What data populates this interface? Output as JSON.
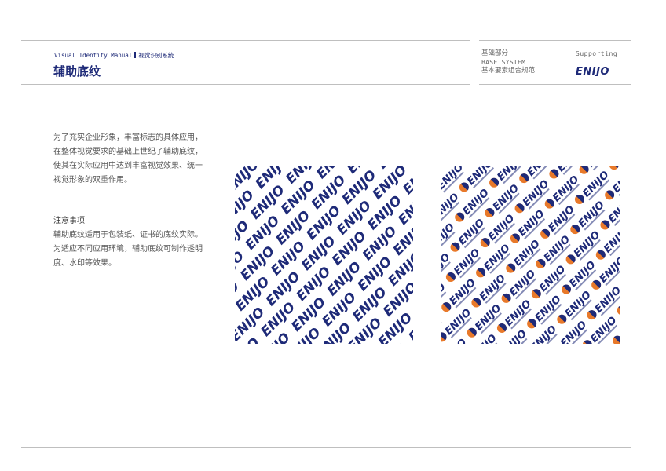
{
  "header": {
    "manual_label": "Visual Identity Manual",
    "manual_label_cn": "视觉识别系统",
    "page_title": "辅助底纹",
    "section_cn": "基础部分",
    "section_en": "BASE SYSTEM",
    "section_sub": "基本要素组合规范",
    "supporting": "Supporting",
    "logo_text": "ENIJO"
  },
  "intro": {
    "lines": [
      "为了充实企业形象，丰富标志的具体应用，",
      "在整体视觉要求的基础上世纪了辅助底纹，",
      "使其在实际应用中达到丰富视觉效果、统一",
      "视觉形象的双重作用。"
    ]
  },
  "notes": {
    "heading": "注意事项",
    "lines": [
      "辅助底纹适用于包装纸、证书的底纹实际。",
      "为适应不同应用环境，辅助底纹可制作透明",
      "度、水印等效果。"
    ]
  },
  "patterns": {
    "word": "ENIJO",
    "colors": {
      "navy": "#1e2a78",
      "orange": "#e8792a"
    }
  }
}
